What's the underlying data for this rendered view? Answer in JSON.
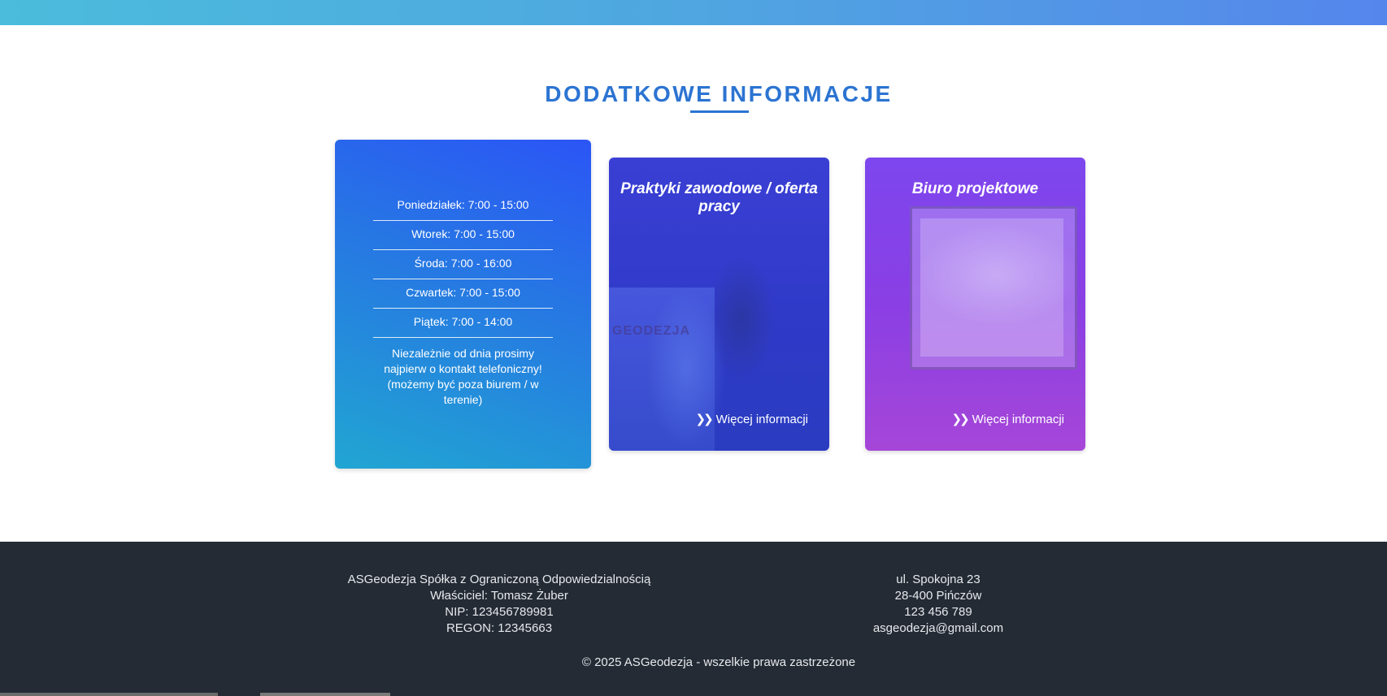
{
  "section": {
    "title": "DODATKOWE INFORMACJE"
  },
  "hours": {
    "rows": [
      "Poniedziałek: 7:00 - 15:00",
      "Wtorek: 7:00 - 15:00",
      "Środa: 7:00 - 16:00",
      "Czwartek: 7:00 - 15:00",
      "Piątek: 7:00 - 14:00"
    ],
    "note": "Niezależnie od dnia prosimy najpierw o kontakt telefoniczny! (możemy być poza biurem / w terenie)"
  },
  "cards": [
    {
      "title": "Praktyki zawodowe / oferta pracy",
      "link": "Więcej informacji",
      "image_text": "GEODEZJA"
    },
    {
      "title": "Biuro projektowe",
      "link": "Więcej informacji"
    }
  ],
  "footer": {
    "left": [
      "ASGeodezja Spółka z Ograniczoną Odpowiedzialnością",
      "Właściciel: Tomasz Żuber",
      "NIP: 123456789981",
      "REGON: 12345663"
    ],
    "right": [
      "ul. Spokojna 23",
      "28-400 Pińczów",
      "123 456 789",
      "asgeodezja@gmail.com"
    ],
    "copyright": "© 2025 ASGeodezja - wszelkie prawa zastrzeżone"
  },
  "colors": {
    "accent": "#2c74d2",
    "footer_bg": "#242b35",
    "card_blue": "#2b55f6",
    "card_indigo": "#2f3ac8",
    "card_purple": "#8a3fe4"
  }
}
